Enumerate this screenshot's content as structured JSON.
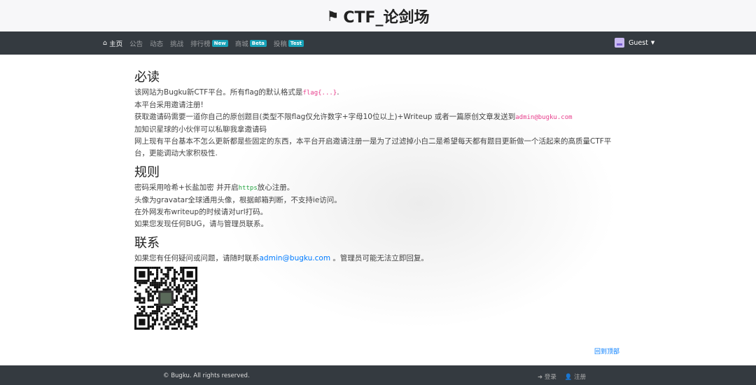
{
  "header": {
    "title": "CTF_论剑场",
    "icon": "flag-icon"
  },
  "nav": {
    "items": [
      {
        "label": "主页",
        "active": true
      },
      {
        "label": "公告"
      },
      {
        "label": "动态"
      },
      {
        "label": "挑战"
      },
      {
        "label": "排行榜",
        "badge": "New"
      },
      {
        "label": "商城",
        "badge": "Beta"
      },
      {
        "label": "投稿",
        "badge": "Test"
      }
    ],
    "user": "Guest"
  },
  "must_read": {
    "title": "必读",
    "line1_pre": "该网站为Bugku新CTF平台。所有flag的默认格式是",
    "line1_code": "flag{...}",
    "line1_post": ".",
    "line2": "本平台采用邀请注册!",
    "line3_pre": "获取邀请码需要一道你自己的原创题目(类型不限flag仅允许数字+字母10位以上)+Writeup 或者一篇原创文章发送到",
    "line3_code": "admin@bugku.com",
    "line4": "加知识星球的小伙伴可以私聊我拿邀请码",
    "line5": "网上现有平台基本不怎么更新都是些固定的东西，本平台开启邀请注册一是为了过滤掉小白二是希望每天都有题目更新做一个活起来的高质量CTF平台，更能调动大家积极性."
  },
  "rules": {
    "title": "规则",
    "line1_pre": "密码采用哈希+长盐加密 并开启",
    "line1_code": "https",
    "line1_post": "放心注册。",
    "line2": "头像为gravatar全球通用头像，根据邮箱判断，不支持ie访问。",
    "line3": "在外网发布writeup的时候请对url打码。",
    "line4": "如果您发现任何BUG，请与管理员联系。"
  },
  "contact": {
    "title": "联系",
    "pre": "如果您有任何疑问或问题，请随时联系",
    "email": "admin@bugku.com",
    "post": " 。管理员可能无法立即回复。"
  },
  "back_to_top": "回到顶部",
  "footer": {
    "copyright": "© Bugku. All rights reserved.",
    "login": "登录",
    "register": "注册"
  }
}
